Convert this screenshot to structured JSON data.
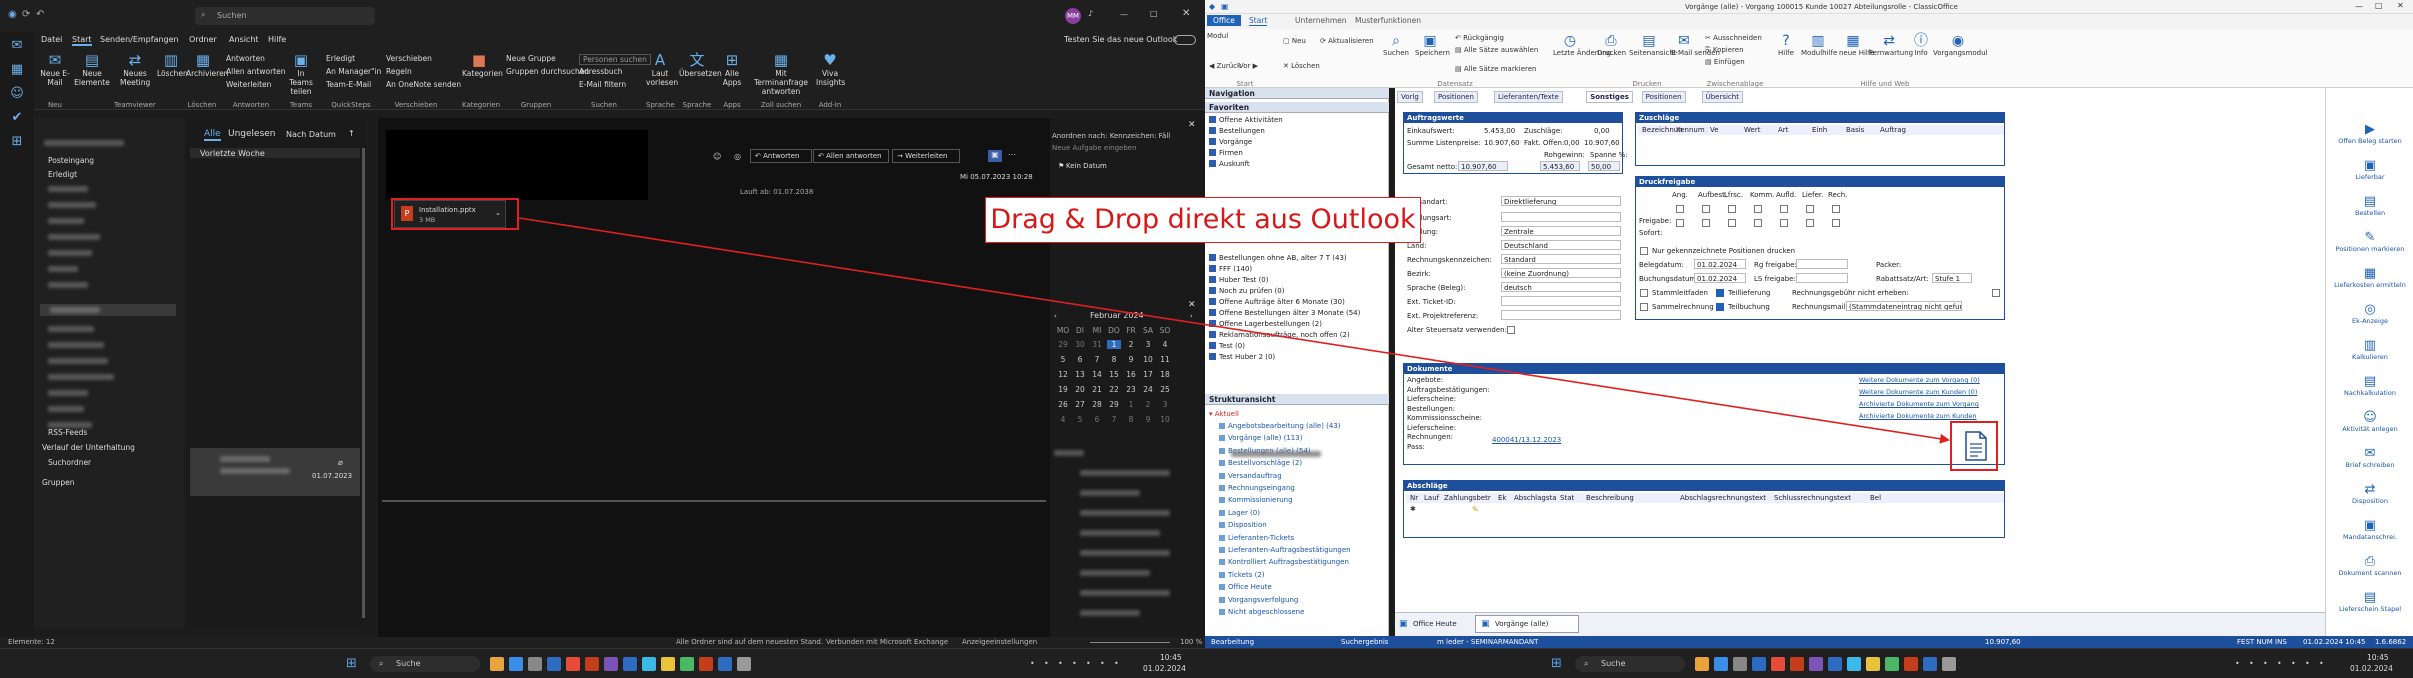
{
  "outlook": {
    "search_placeholder": "Suchen",
    "avatar": "MM",
    "try_new": "Testen Sie das neue Outlook",
    "menu": [
      "Datei",
      "Start",
      "Senden/Empfangen",
      "Ordner",
      "Ansicht",
      "Hilfe"
    ],
    "ribbon": {
      "new_email": "Neue E-Mail",
      "new_items": "Neue Elemente",
      "new_meeting": "Neues Meeting",
      "delete": "Löschen",
      "archive": "Archivieren",
      "reply": "Antworten",
      "reply_all": "Allen antworten",
      "forward": "Weiterleiten",
      "teams_share": "In Teams teilen",
      "quickstep1": "Erledigt",
      "quickstep2": "An Manager\"in",
      "quickstep3": "Team-E-Mail",
      "move": "Verschieben",
      "rules": "Regeln",
      "onenote": "An OneNote senden",
      "categorize": "Kategorien",
      "new_group": "Neue Gruppe",
      "browse_groups": "Gruppen durchsuchen",
      "search_people": "Personen suchen",
      "address_book": "Adressbuch",
      "filter_email": "E-Mail filtern",
      "read_aloud": "Laut vorlesen",
      "translate": "Übersetzen",
      "all_apps": "Alle Apps",
      "meeting_reply": "Mit Terminanfrage antworten",
      "viva": "Viva Insights",
      "groups": [
        "Neu",
        "Teamviewer",
        "Löschen",
        "Antworten",
        "Teams",
        "QuickSteps",
        "Verschieben",
        "Kategorien",
        "Gruppen",
        "Suchen",
        "Sprache",
        "Sprache",
        "Apps",
        "Zoll suchen",
        "Add-In"
      ]
    },
    "folders": {
      "posteingang": "Posteingang",
      "erledigt": "Erledigt",
      "rss": "RSS-Feeds",
      "verlauf": "Verlauf der Unterhaltung",
      "suchordner": "Suchordner",
      "gruppen": "Gruppen"
    },
    "list": {
      "tab_all": "Alle",
      "tab_unread": "Ungelesen",
      "sort": "Nach Datum",
      "section": "Vorletzte Woche",
      "item_date": "01.07.2023"
    },
    "reading": {
      "reply": "Antworten",
      "reply_all": "Allen antworten",
      "forward": "Weiterleiten",
      "timestamp": "Mi 05.07.2023 10:28",
      "meta": "Lauft ab: 01.07.2038",
      "attachment_name": "Installation.pptx",
      "attachment_size": "3 MB"
    },
    "todo": {
      "arrange": "Anordnen nach: Kennzeichen: Fälli...",
      "new_task": "Neue Aufgabe eingeben",
      "no_date": "Kein Datum"
    },
    "calendar": {
      "month": "Februar 2024",
      "weekdays": [
        "MO",
        "DI",
        "MI",
        "DO",
        "FR",
        "SA",
        "SO"
      ],
      "weeks": [
        [
          "29",
          "30",
          "31",
          "1",
          "2",
          "3",
          "4"
        ],
        [
          "5",
          "6",
          "7",
          "8",
          "9",
          "10",
          "11"
        ],
        [
          "12",
          "13",
          "14",
          "15",
          "16",
          "17",
          "18"
        ],
        [
          "19",
          "20",
          "21",
          "22",
          "23",
          "24",
          "25"
        ],
        [
          "26",
          "27",
          "28",
          "29",
          "1",
          "2",
          "3"
        ],
        [
          "4",
          "5",
          "6",
          "7",
          "8",
          "9",
          "10"
        ]
      ],
      "today": "1"
    },
    "status": {
      "items": "Elemente: 12",
      "folders_uptodate": "Alle Ordner sind auf dem neuesten Stand.",
      "connected": "Verbunden mit Microsoft Exchange",
      "display": "Anzeigeeinstellungen",
      "zoom": "100 %"
    }
  },
  "taskbar": {
    "search": "Suche",
    "time": "10:45",
    "date": "01.02.2024",
    "time2": "10:45",
    "date2": "01.02.2024"
  },
  "crm": {
    "title": "Vorgänge (alle) - Vorgang 100015 Kunde 10027 Abteilungsrolle - ClassicOffice",
    "tabs": [
      "Office",
      "Start",
      "Unternehmen",
      "Musterfunktionen"
    ],
    "ribbon": {
      "modul": "Modul",
      "zurueck": "Zurück",
      "vor": "Vor",
      "neu": "Neu",
      "loeschen": "Löschen",
      "aktualisieren": "Aktualisieren",
      "suchen": "Suchen",
      "speichern": "Speichern",
      "rueckgaengig": "Rückgängig",
      "alle_aus": "Alle Sätze auswählen",
      "alle_markieren": "Alle Sätze markieren",
      "letzte_aenderung": "Letzte Änderung...",
      "drucken": "Drucken",
      "seitenansicht": "Seitenansicht",
      "email": "E-Mail senden",
      "ausschneiden": "Ausschneiden",
      "kopieren": "Kopieren",
      "einfuegen": "Einfügen",
      "hilfe": "Hilfe",
      "modulhilfe": "Modulhilfe",
      "neuehilfe": "neue Hilfe",
      "fernwartung": "Fernwartung",
      "info": "Info",
      "vorgang": "Vorgangsmodul",
      "groups": [
        "Start",
        "Datensatz",
        "Drucken",
        "Zwischenablage",
        "Hilfe und Web"
      ]
    },
    "nav": {
      "title": "Navigation",
      "favoriten": "Favoriten",
      "fav_items": [
        "Offene Aktivitäten",
        "Bestellungen",
        "Vorgänge",
        "Firmen",
        "Auskunft"
      ],
      "list_items": [
        "Bestellungen ohne AB, alter 7 T (43)",
        "FFF (140)",
        "Huber Test (0)",
        "Noch zu prüfen (0)",
        "Offene Aufträge älter 6 Monate (30)",
        "Offene Bestellungen älter 3 Monate (54)",
        "Offene Lagerbestellungen (2)",
        "Reklamationsaufträge, noch offen (2)",
        "Test (0)",
        "Test Huber 2 (0)"
      ],
      "struktur": "Strukturansicht",
      "aktuell": "Aktuell",
      "tree_items": [
        "Angebotsbearbeitung (alle) (43)",
        "Vorgänge (alle) (113)",
        "Bestellungen (alle) (54)",
        "Bestellvorschläge (2)",
        "Versandauftrag",
        "Rechnungseingang",
        "Kommissionierung",
        "Lager (0)",
        "Disposition",
        "Lieferanten-Tickets",
        "Lieferanten-Auftragsbestätigungen",
        "Kontrolliert Auftragsbestätigungen",
        "Tickets (2)",
        "Office Heute",
        "Vorgangsverfolgung",
        "Nicht abgeschlossene"
      ]
    },
    "main_tabs": [
      "Vorlg",
      "Positionen",
      "Lieferanten/Texte",
      "Sonstiges",
      "Positionen",
      "Übersicht"
    ],
    "auftrag": {
      "title": "Auftragswerte",
      "einkaufswert_l": "Einkaufswert:",
      "einkaufswert": "5.453,00",
      "zuschlaege_l": "Zuschläge:",
      "zuschlaege": "0,00",
      "listenpreis_l": "Summe Listenpreise:",
      "listenpreis": "10.907,60",
      "fakt_l": "Fakt. Offen:",
      "fakt": "0,00",
      "fakt2": "10.907,60",
      "gesamt_l": "Gesamt netto:",
      "gesamt": "10.907,60",
      "rohgewinn_l": "Rohgewinn:",
      "rohgewinn": "5.453,60",
      "spanne_l": "Spanne %:",
      "spanne": "50,00"
    },
    "zuschlaege_table": {
      "title": "Zuschläge",
      "cols": [
        "Bezeichnun",
        "Kennum",
        "Ve",
        "Wert",
        "Art",
        "Einh",
        "Basis",
        "Auftrag"
      ]
    },
    "fields": {
      "versandart_l": "Versandart:",
      "versandart": "Direktlieferung",
      "zahlungsart_l": "Zahlungsart:",
      "zahlung_l": "Zahlung:",
      "zahlung": "Zentrale",
      "land_l": "Land:",
      "land": "Deutschland",
      "rechnung_l": "Rechnungskennzeichen:",
      "rechnung": "Standard",
      "bezirk_l": "Bezirk:",
      "bezirk": "(keine Zuordnung)",
      "sprache_l": "Sprache (Beleg):",
      "sprache": "deutsch",
      "ticket_l": "Ext. Ticket-ID:",
      "projekt_l": "Ext. Projektreferenz:",
      "steuer_l": "Alter Steuersatz verwenden:"
    },
    "druck": {
      "title": "Druckfreigabe",
      "cols": [
        "Ang.",
        "Aufbest.",
        "Lfrsc.",
        "Komm.",
        "Aufld.",
        "Liefer.",
        "Rech."
      ],
      "freigabe": "Freigabe:",
      "sofort": "Sofort:",
      "nur_gekennz": "Nur gekennzeichnete Positionen drucken",
      "belegdatum_l": "Belegdatum:",
      "belegdatum": "01.02.2024",
      "rgfreigabe_l": "Rg freigabe:",
      "buchungsdatum_l": "Buchungsdatum:",
      "buchungsdatum": "01.02.2024",
      "ls_l": "LS freigabe:",
      "packer_l": "Packer:",
      "rabatt_l": "Rabattsatz/Art:",
      "rabatt": "Stufe 1",
      "stammleitfaden": "Stammleitfaden",
      "teillieferung": "Teillieferung",
      "sammelrechnung": "Sammelrechnung",
      "teilbuchung": "Teilbuchung",
      "rechnungsgebuehr": "Rechnungsgebühr nicht erheben:",
      "rechnungsmail_l": "Rechnungsmail:",
      "rechnungsmail": "(Stammdateneintrag nicht gefunden)"
    },
    "dokumente": {
      "title": "Dokumente",
      "rows": [
        "Angebote:",
        "Auftragsbestätigungen:",
        "Lieferscheine:",
        "Bestellungen:",
        "Kommissionsscheine:",
        "Lieferscheine:",
        "Rechnungen:",
        "Pass:"
      ],
      "lieferschein_link": "400041/13.12.2023",
      "links": [
        "Weitere Dokumente zum Vorgang (0)",
        "Weitere Dokumente zum Kunden (0)",
        "Archivierte Dokumente zum Vorgang",
        "Archivierte Dokumente zum Kunden"
      ]
    },
    "abschlaege": {
      "title": "Abschläge",
      "cols": [
        "Nr",
        "Lauf",
        "Zahlungsbetr",
        "Ek",
        "Abschlagsta",
        "Stat",
        "Beschreibung",
        "Abschlagsrechnungstext",
        "Schlussrechnungstext",
        "Bel"
      ]
    },
    "side": [
      "Offen Beleg starten",
      "Lieferbar",
      "Bestellen",
      "Positionen markieren",
      "Lieferkosten ermitteln",
      "Ek-Anzeige",
      "Kalkulieren",
      "Nachkalkulation",
      "Aktivität anlegen",
      "Brief schreiben",
      "Disposition",
      "Mandatanschrei.",
      "Dokument scannen",
      "Lieferschein Stapel"
    ],
    "bottom_tabs": [
      "Office Heute",
      "Vorgänge (alle)"
    ],
    "status": {
      "left": "Bearbeitung",
      "search": "Suchergebnis",
      "user": "m leder - SEMINARMANDANT",
      "right": "10.907,60",
      "flags": "FEST  NUM  INS",
      "datetime": "01.02.2024  10:45",
      "id": "1.6.6862"
    }
  },
  "overlay": {
    "caption": "Drag & Drop direkt aus Outlook"
  },
  "colors": {
    "accent_red": "#e02020",
    "crm_blue": "#1e4f9c",
    "outlook_blue": "#6ab0ea"
  }
}
